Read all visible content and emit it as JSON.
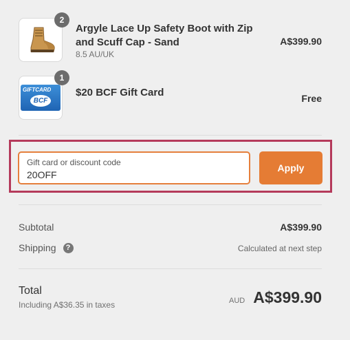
{
  "items": [
    {
      "title_line1": "Argyle Lace Up Safety Boot with Zip",
      "title_line2": "and Scuff Cap - Sand",
      "variant": "8.5 AU/UK",
      "quantity": "2",
      "price": "A$399.90"
    },
    {
      "title_line1": "$20 BCF Gift Card",
      "quantity": "1",
      "price": "Free",
      "card_text_top": "GIFTCARD",
      "card_text_logo": "BCF"
    }
  ],
  "discount": {
    "label": "Gift card or discount code",
    "value": "20OFF",
    "apply_label": "Apply"
  },
  "summary": {
    "subtotal_label": "Subtotal",
    "subtotal_value": "A$399.90",
    "shipping_label": "Shipping",
    "shipping_value": "Calculated at next step",
    "help_glyph": "?"
  },
  "total": {
    "label": "Total",
    "taxes_note": "Including A$36.35 in taxes",
    "currency": "AUD",
    "value": "A$399.90"
  },
  "colors": {
    "accent": "#e57c34",
    "highlight_border": "#b53a5b"
  }
}
